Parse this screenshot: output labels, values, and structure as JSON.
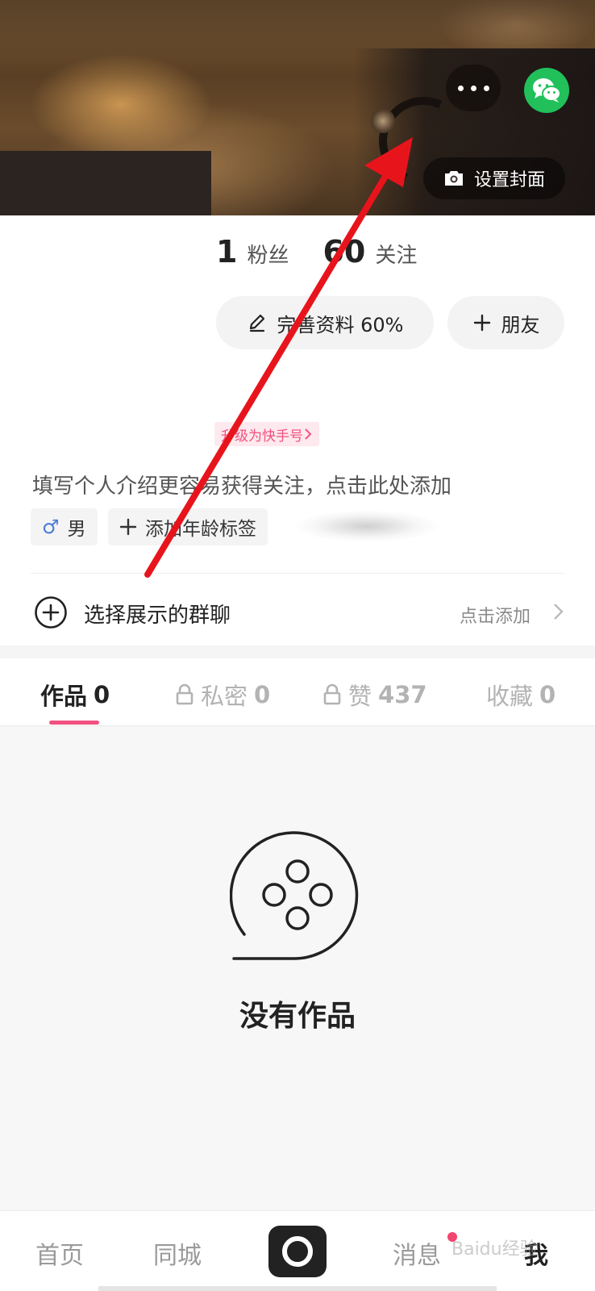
{
  "cover": {
    "set_cover_label": "设置封面",
    "icons": [
      "more-icon",
      "wechat-icon",
      "camera-icon"
    ]
  },
  "stats": {
    "fans_count": "1",
    "fans_label": "粉丝",
    "following_count": "60",
    "following_label": "关注"
  },
  "actions": {
    "edit_profile_label": "完善资料 60%",
    "add_friend_label": "朋友"
  },
  "profile": {
    "upgrade_label": "升级为快手号",
    "bio_placeholder": "填写个人介绍更容易获得关注，点击此处添加",
    "gender_symbol": "♂",
    "gender_label": "男",
    "add_age_label": "添加年龄标签"
  },
  "group": {
    "label": "选择展示的群聊",
    "action": "点击添加"
  },
  "tabs": [
    {
      "label": "作品",
      "count": "0",
      "locked": false,
      "active": true
    },
    {
      "label": "私密",
      "count": "0",
      "locked": true,
      "active": false
    },
    {
      "label": "赞",
      "count": "437",
      "locked": true,
      "active": false
    },
    {
      "label": "收藏",
      "count": "0",
      "locked": false,
      "active": false
    }
  ],
  "empty": {
    "text": "没有作品"
  },
  "nav": {
    "home": "首页",
    "local": "同城",
    "messages": "消息",
    "me": "我"
  },
  "watermark": "Baidu经验",
  "colors": {
    "accent": "#f25080",
    "wechat": "#21c05b",
    "annotation_arrow": "#e8141c"
  }
}
